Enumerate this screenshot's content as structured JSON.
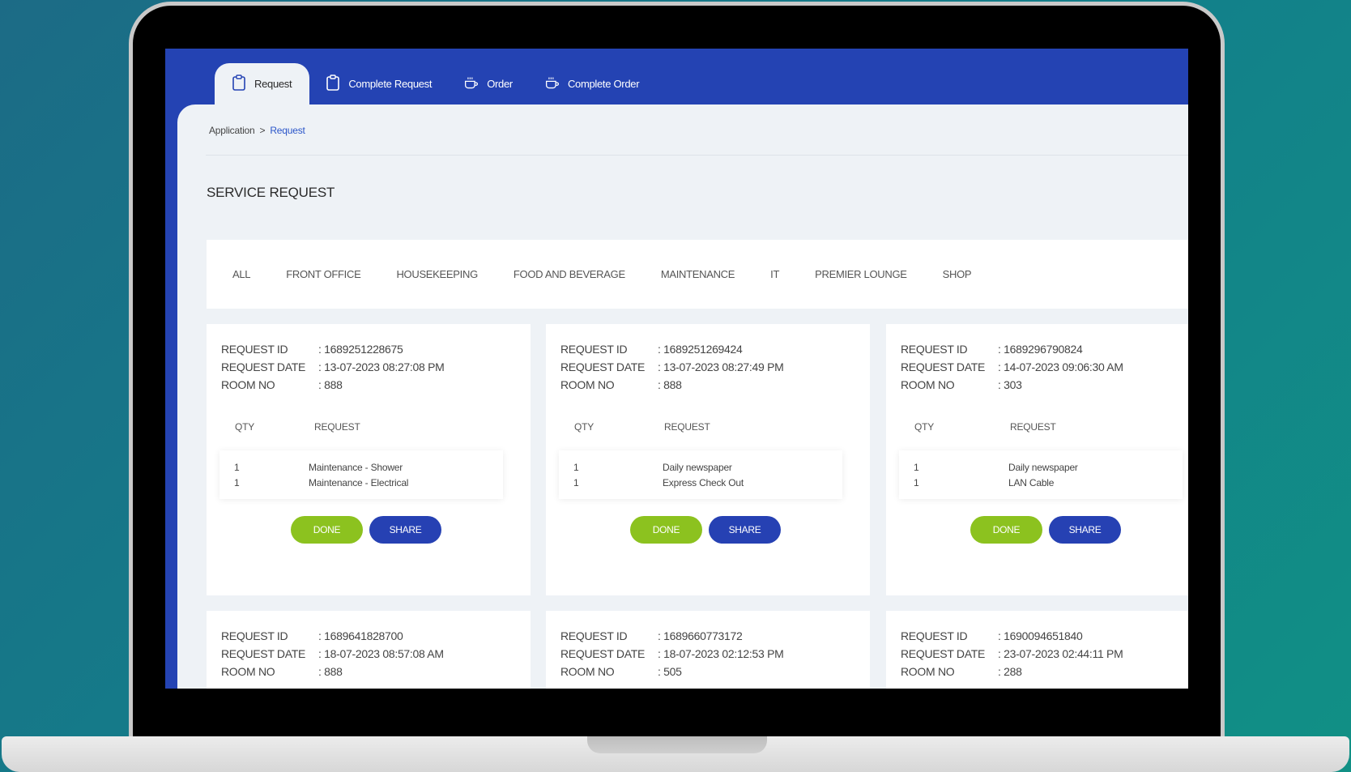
{
  "tabs": [
    {
      "label": "Request",
      "icon": "clipboard-icon"
    },
    {
      "label": "Complete Request",
      "icon": "clipboard-icon"
    },
    {
      "label": "Order",
      "icon": "cup-icon"
    },
    {
      "label": "Complete Order",
      "icon": "cup-icon"
    }
  ],
  "breadcrumb": {
    "root": "Application",
    "separator": ">",
    "current": "Request"
  },
  "page_title": "SERVICE REQUEST",
  "filters": [
    "ALL",
    "FRONT OFFICE",
    "HOUSEKEEPING",
    "FOOD AND BEVERAGE",
    "MAINTENANCE",
    "IT",
    "PREMIER LOUNGE",
    "SHOP"
  ],
  "labels": {
    "request_id": "REQUEST ID",
    "request_date": "REQUEST DATE",
    "room_no": "ROOM NO",
    "qty": "QTY",
    "request": "REQUEST",
    "done": "DONE",
    "share": "SHARE"
  },
  "cards": [
    {
      "id": ": 1689251228675",
      "date": ": 13-07-2023 08:27:08 PM",
      "room": ": 888",
      "items": [
        {
          "qty": "1",
          "name": "Maintenance - Shower"
        },
        {
          "qty": "1",
          "name": "Maintenance - Electrical"
        }
      ]
    },
    {
      "id": ": 1689251269424",
      "date": ": 13-07-2023 08:27:49 PM",
      "room": ": 888",
      "items": [
        {
          "qty": "1",
          "name": "Daily newspaper"
        },
        {
          "qty": "1",
          "name": "Express Check Out"
        }
      ]
    },
    {
      "id": ": 1689296790824",
      "date": ": 14-07-2023 09:06:30 AM",
      "room": ": 303",
      "items": [
        {
          "qty": "1",
          "name": "Daily newspaper"
        },
        {
          "qty": "1",
          "name": "LAN Cable"
        }
      ]
    },
    {
      "id": ": 1689641828700",
      "date": ": 18-07-2023 08:57:08 AM",
      "room": ": 888"
    },
    {
      "id": ": 1689660773172",
      "date": ": 18-07-2023 02:12:53 PM",
      "room": ": 505"
    },
    {
      "id": ": 1690094651840",
      "date": ": 23-07-2023 02:44:11 PM",
      "room": ": 288"
    }
  ],
  "colors": {
    "primary": "#2443b3",
    "done": "#8cc21f",
    "share": "#2641b3",
    "background": "#eef2f6"
  }
}
